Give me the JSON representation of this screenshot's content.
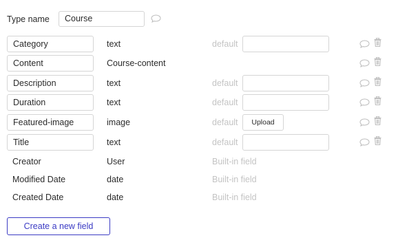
{
  "type_name": {
    "label": "Type name",
    "value": "Course"
  },
  "fields": [
    {
      "name": "Category",
      "type": "text",
      "default_label": "default",
      "default_kind": "input",
      "default_value": ""
    },
    {
      "name": "Content",
      "type": "Course-content",
      "default_label": "",
      "default_kind": "none",
      "default_value": ""
    },
    {
      "name": "Description",
      "type": "text",
      "default_label": "default",
      "default_kind": "input",
      "default_value": ""
    },
    {
      "name": "Duration",
      "type": "text",
      "default_label": "default",
      "default_kind": "input",
      "default_value": ""
    },
    {
      "name": "Featured-image",
      "type": "image",
      "default_label": "default",
      "default_kind": "upload",
      "upload_label": "Upload"
    },
    {
      "name": "Title",
      "type": "text",
      "default_label": "default",
      "default_kind": "input",
      "default_value": ""
    }
  ],
  "builtin_fields": [
    {
      "name": "Creator",
      "type": "User",
      "note": "Built-in field"
    },
    {
      "name": "Modified Date",
      "type": "date",
      "note": "Built-in field"
    },
    {
      "name": "Created Date",
      "type": "date",
      "note": "Built-in field"
    }
  ],
  "create_button_label": "Create a new field",
  "colors": {
    "accent": "#3b3bc4",
    "muted": "#c4c4c4",
    "border": "#d5d5d5",
    "icon": "#bcbcbc"
  },
  "icons": {
    "comment": "speech-bubble-icon",
    "delete": "trash-icon"
  }
}
